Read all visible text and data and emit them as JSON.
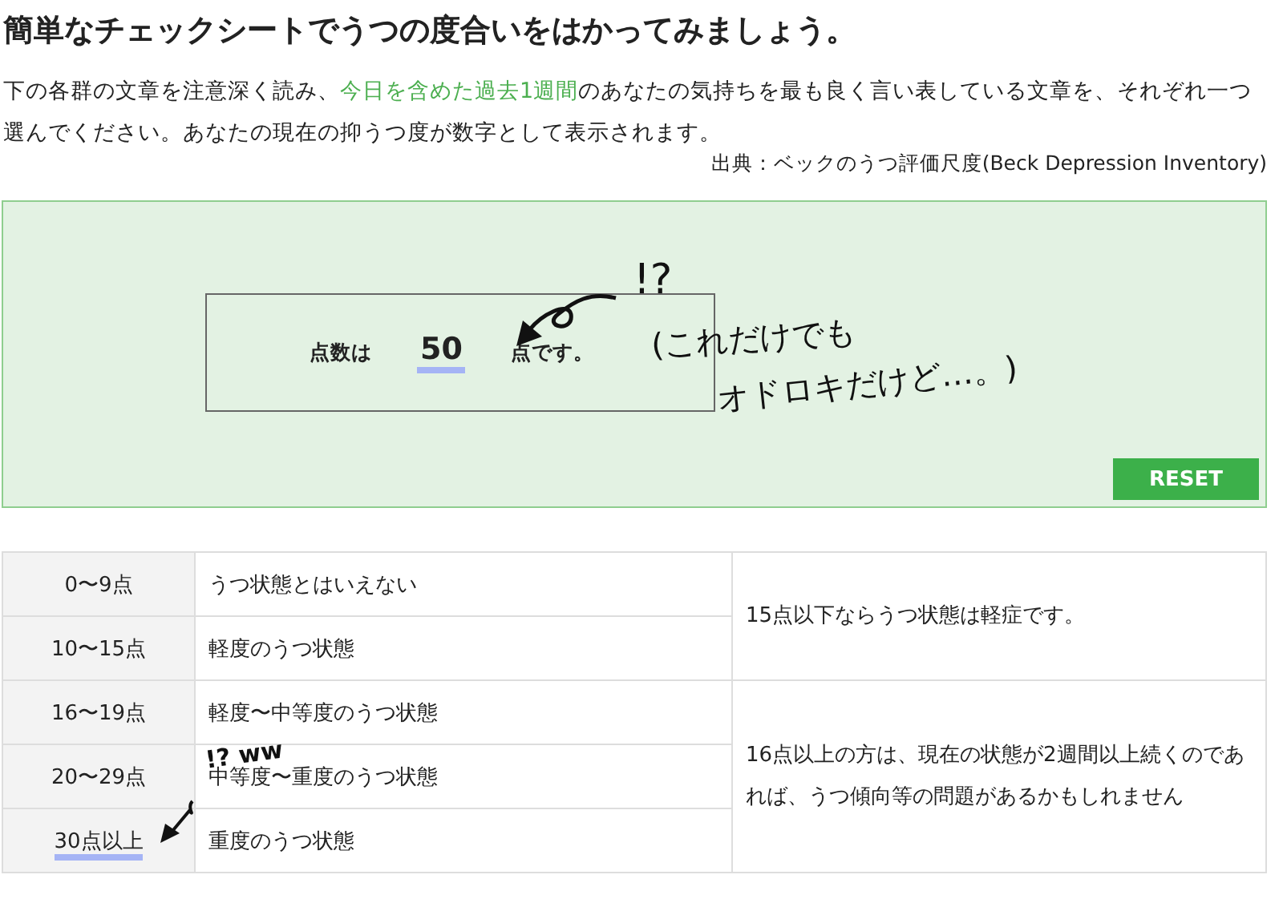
{
  "title": "簡単なチェックシートでうつの度合いをはかってみましょう。",
  "intro": [
    {
      "text": "下の各群の文章を注意深く読み、",
      "highlight": false
    },
    {
      "text": "今日を含めた過去1週間",
      "highlight": true
    },
    {
      "text": "のあなたの気持ちを最も良く言い表している文章を、それぞれ一つ選んでください。あなたの現在の抑うつ度が数字として表示されます。",
      "highlight": false
    }
  ],
  "source": "出典：ベックのうつ評価尺度(Beck Depression Inventory)",
  "score": {
    "prefix": "点数は",
    "value": "50",
    "suffix": "点です。",
    "underlined": true
  },
  "reset_button": "RESET",
  "annotations": [
    {
      "text": "!?",
      "kind": "big"
    },
    {
      "text": "(これだけでも",
      "kind": "line1"
    },
    {
      "text": "オドロキだけど…。)",
      "kind": "line2"
    },
    {
      "text": "!? ww",
      "kind": "small"
    }
  ],
  "table": {
    "groups": [
      {
        "note": "15点以下ならうつ状態は軽症です。",
        "rows": [
          {
            "range": "0〜9点",
            "state": "うつ状態とはいえない",
            "underlined": false
          },
          {
            "range": "10〜15点",
            "state": "軽度のうつ状態",
            "underlined": false
          }
        ]
      },
      {
        "note": "16点以上の方は、現在の状態が2週間以上続くのであれば、うつ傾向等の問題があるかもしれません",
        "rows": [
          {
            "range": "16〜19点",
            "state": "軽度〜中等度のうつ状態",
            "underlined": false
          },
          {
            "range": "20〜29点",
            "state": "中等度〜重度のうつ状態",
            "underlined": false
          },
          {
            "range": "30点以上",
            "state": "重度のうつ状態",
            "underlined": true
          }
        ]
      }
    ]
  }
}
